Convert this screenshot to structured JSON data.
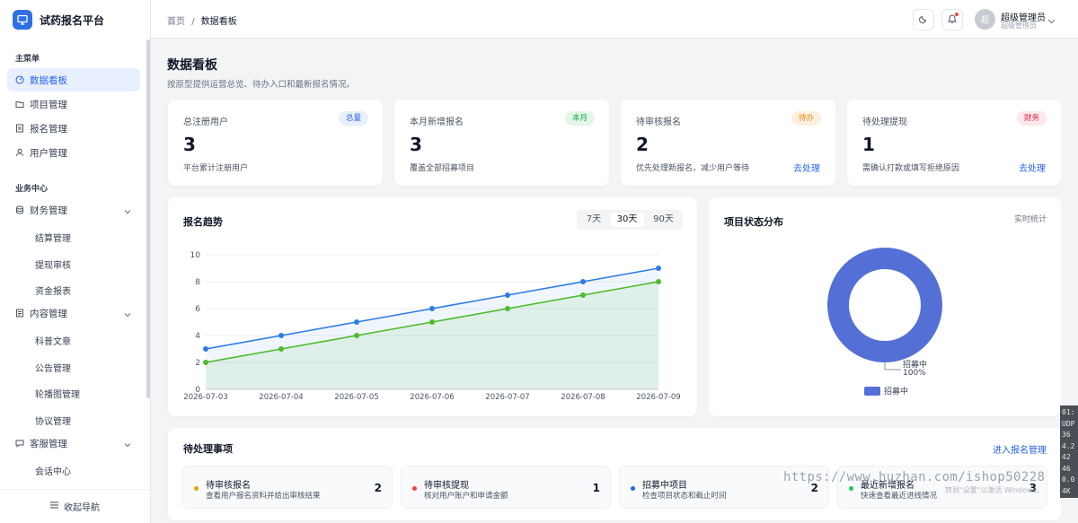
{
  "app": {
    "title": "试药报名平台"
  },
  "sidebar": {
    "section_main": "主菜单",
    "main_items": [
      {
        "label": "数据看板",
        "icon": "dashboard-icon",
        "active": true
      },
      {
        "label": "项目管理",
        "icon": "folder-icon"
      },
      {
        "label": "报名管理",
        "icon": "document-icon"
      },
      {
        "label": "用户管理",
        "icon": "user-icon"
      }
    ],
    "section_business": "业务中心",
    "groups": [
      {
        "label": "财务管理",
        "icon": "database-icon",
        "children": [
          "结算管理",
          "提现审核",
          "资金报表"
        ]
      },
      {
        "label": "内容管理",
        "icon": "article-icon",
        "children": [
          "科普文章",
          "公告管理",
          "轮播图管理",
          "协议管理"
        ]
      },
      {
        "label": "客服管理",
        "icon": "chat-icon",
        "children": [
          "会话中心"
        ]
      }
    ],
    "collapse_label": "收起导航"
  },
  "header": {
    "breadcrumb_home": "首页",
    "breadcrumb_sep": "/",
    "breadcrumb_current": "数据看板",
    "user_avatar_text": "超",
    "user_name": "超级管理员",
    "user_role": "超级管理员"
  },
  "page": {
    "title": "数据看板",
    "subtitle": "按原型提供运营总览、待办入口和最新报名情况。"
  },
  "stats": [
    {
      "label": "总注册用户",
      "badge": "总量",
      "value": "3",
      "desc": "平台累计注册用户",
      "link": "",
      "badge_bg": "#e8f0fe",
      "badge_fg": "#2563eb"
    },
    {
      "label": "本月新增报名",
      "badge": "本月",
      "value": "3",
      "desc": "覆盖全部招募项目",
      "link": "",
      "badge_bg": "#e3f7e6",
      "badge_fg": "#16a34a"
    },
    {
      "label": "待审核报名",
      "badge": "待办",
      "value": "2",
      "desc": "优先处理新报名，减少用户等待",
      "link": "去处理",
      "badge_bg": "#fdf0df",
      "badge_fg": "#ea8a1a"
    },
    {
      "label": "待处理提现",
      "badge": "财务",
      "value": "1",
      "desc": "需确认打款或填写拒绝原因",
      "link": "去处理",
      "badge_bg": "#fde8ea",
      "badge_fg": "#e11d48"
    }
  ],
  "trend": {
    "title": "报名趋势",
    "ranges": [
      "7天",
      "30天",
      "90天"
    ],
    "selected_range": "30天"
  },
  "distribution": {
    "title": "项目状态分布",
    "note": "实时统计"
  },
  "pending": {
    "title": "待处理事项",
    "link": "进入报名管理",
    "items": [
      {
        "name": "待审核报名",
        "desc": "查看用户报名资料并给出审核结果",
        "count": "2",
        "color": "#f59e0b"
      },
      {
        "name": "待审核提现",
        "desc": "核对用户账户和申请金额",
        "count": "1",
        "color": "#ef4444"
      },
      {
        "name": "招募中项目",
        "desc": "检查项目状态和截止时间",
        "count": "2",
        "color": "#2563eb"
      },
      {
        "name": "最近新增报名",
        "desc": "快速查看最近进线情况",
        "count": "3",
        "color": "#22c55e"
      }
    ]
  },
  "overlay": {
    "watermark": "https://www.huzhan.com/ishop50228",
    "activate_windows": "转到\"设置\"以激活 Windows。",
    "terminal_lines": [
      "01:",
      "UDP",
      "36",
      "4.2",
      "42",
      "46",
      "0.0",
      "4K"
    ]
  },
  "colors": {
    "accent": "#2563eb",
    "line_blue": "#2f7be6",
    "line_green": "#4cbb2d",
    "donut": "#5470d6"
  },
  "chart_data": [
    {
      "type": "line",
      "title": "报名趋势",
      "x": [
        "2026-07-03",
        "2026-07-04",
        "2026-07-05",
        "2026-07-06",
        "2026-07-07",
        "2026-07-08",
        "2026-07-09"
      ],
      "series": [
        {
          "values": [
            3,
            4,
            5,
            6,
            7,
            8,
            9
          ],
          "color": "#2f7be6"
        },
        {
          "values": [
            2,
            3,
            4,
            5,
            6,
            7,
            8
          ],
          "color": "#4cbb2d"
        }
      ],
      "yticks": [
        0,
        2,
        4,
        6,
        8,
        10
      ],
      "ylim": [
        0,
        10
      ],
      "grid": true
    },
    {
      "type": "pie",
      "title": "项目状态分布",
      "slices": [
        {
          "label": "招募中",
          "value": 100,
          "display": "100%",
          "color": "#5470d6"
        }
      ],
      "legend": [
        "招募中"
      ],
      "legend_position": "bottom"
    }
  ]
}
